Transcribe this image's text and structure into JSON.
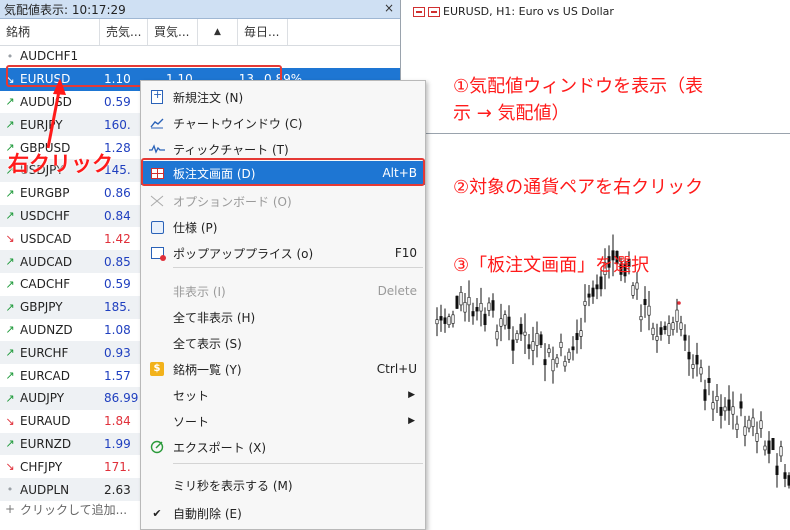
{
  "market_watch": {
    "title": "気配値表示: 10:17:29",
    "close": "×",
    "columns": [
      "銘柄",
      "売気...",
      "買気...",
      "▲",
      "毎日..."
    ],
    "rows": [
      {
        "arrow": "•",
        "dir": "neu",
        "symbol": "AUDCHF1",
        "bid": "",
        "ask": "",
        "spread": "",
        "change": "",
        "bid_color": "blue"
      },
      {
        "arrow": "↘",
        "dir": "dn",
        "symbol": "EURUSD",
        "bid": "1.10",
        "ask": "1.10",
        "spread": "13",
        "change": "0.89%",
        "bid_color": "blue",
        "selected": true
      },
      {
        "arrow": "↗",
        "dir": "up",
        "symbol": "AUDUSD",
        "bid": "0.59",
        "ask": "",
        "spread": "",
        "change": "",
        "bid_color": "blue"
      },
      {
        "arrow": "↗",
        "dir": "up",
        "symbol": "EURJPY",
        "bid": "160.",
        "ask": "",
        "spread": "",
        "change": "",
        "bid_color": "blue"
      },
      {
        "arrow": "↗",
        "dir": "up",
        "symbol": "GBPUSD",
        "bid": "1.28",
        "ask": "",
        "spread": "",
        "change": "",
        "bid_color": "blue"
      },
      {
        "arrow": "↗",
        "dir": "up",
        "symbol": "USDJPY",
        "bid": "145.",
        "ask": "",
        "spread": "",
        "change": "",
        "bid_color": "blue"
      },
      {
        "arrow": "↗",
        "dir": "up",
        "symbol": "EURGBP",
        "bid": "0.86",
        "ask": "",
        "spread": "",
        "change": "",
        "bid_color": "blue"
      },
      {
        "arrow": "↗",
        "dir": "up",
        "symbol": "USDCHF",
        "bid": "0.84",
        "ask": "",
        "spread": "",
        "change": "",
        "bid_color": "blue"
      },
      {
        "arrow": "↘",
        "dir": "dn",
        "symbol": "USDCAD",
        "bid": "1.42",
        "ask": "",
        "spread": "",
        "change": "",
        "bid_color": "red"
      },
      {
        "arrow": "↗",
        "dir": "up",
        "symbol": "AUDCAD",
        "bid": "0.85",
        "ask": "",
        "spread": "",
        "change": "",
        "bid_color": "blue"
      },
      {
        "arrow": "↗",
        "dir": "up",
        "symbol": "CADCHF",
        "bid": "0.59",
        "ask": "",
        "spread": "",
        "change": "",
        "bid_color": "blue"
      },
      {
        "arrow": "↗",
        "dir": "up",
        "symbol": "GBPJPY",
        "bid": "185.",
        "ask": "",
        "spread": "",
        "change": "",
        "bid_color": "blue"
      },
      {
        "arrow": "↗",
        "dir": "up",
        "symbol": "AUDNZD",
        "bid": "1.08",
        "ask": "",
        "spread": "",
        "change": "",
        "bid_color": "blue"
      },
      {
        "arrow": "↗",
        "dir": "up",
        "symbol": "EURCHF",
        "bid": "0.93",
        "ask": "",
        "spread": "",
        "change": "",
        "bid_color": "blue"
      },
      {
        "arrow": "↗",
        "dir": "up",
        "symbol": "EURCAD",
        "bid": "1.57",
        "ask": "",
        "spread": "",
        "change": "",
        "bid_color": "blue"
      },
      {
        "arrow": "↗",
        "dir": "up",
        "symbol": "AUDJPY",
        "bid": "86.99",
        "ask": "",
        "spread": "",
        "change": "",
        "bid_color": "blue"
      },
      {
        "arrow": "↘",
        "dir": "dn",
        "symbol": "EURAUD",
        "bid": "1.84",
        "ask": "",
        "spread": "",
        "change": "",
        "bid_color": "red"
      },
      {
        "arrow": "↗",
        "dir": "up",
        "symbol": "EURNZD",
        "bid": "1.99",
        "ask": "",
        "spread": "",
        "change": "",
        "bid_color": "blue"
      },
      {
        "arrow": "↘",
        "dir": "dn",
        "symbol": "CHFJPY",
        "bid": "171.",
        "ask": "",
        "spread": "",
        "change": "",
        "bid_color": "red"
      },
      {
        "arrow": "•",
        "dir": "neu",
        "symbol": "AUDPLN",
        "bid": "2.63",
        "ask": "",
        "spread": "",
        "change": "",
        "bid_color": "plain"
      }
    ],
    "add_symbol": "クリックして追加..."
  },
  "chart": {
    "title": "EURUSD, H1:  Euro vs US Dollar"
  },
  "context_menu": {
    "items": [
      {
        "icon": "new-order-icon",
        "label": "新規注文 (N)",
        "shortcut": "",
        "disabled": false
      },
      {
        "icon": "chart-window-icon",
        "label": "チャートウインドウ (C)",
        "shortcut": "",
        "disabled": false
      },
      {
        "icon": "tick-chart-icon",
        "label": "ティックチャート (T)",
        "shortcut": "",
        "disabled": false
      },
      {
        "icon": "depth-of-market-icon",
        "label": "板注文画面 (D)",
        "shortcut": "Alt+B",
        "disabled": false,
        "highlighted": true
      },
      {
        "icon": "option-board-icon",
        "label": "オプションボード (O)",
        "shortcut": "",
        "disabled": true
      },
      {
        "icon": "specification-icon",
        "label": "仕様 (P)",
        "shortcut": "",
        "disabled": false
      },
      {
        "icon": "popup-prices-icon",
        "label": "ポップアッププライス (o)",
        "shortcut": "F10",
        "disabled": false
      },
      {
        "icon": "",
        "label": "非表示 (I)",
        "shortcut": "Delete",
        "disabled": true
      },
      {
        "icon": "",
        "label": "全て非表示 (H)",
        "shortcut": "",
        "disabled": false
      },
      {
        "icon": "",
        "label": "全て表示 (S)",
        "shortcut": "",
        "disabled": false
      },
      {
        "icon": "symbols-icon",
        "label": "銘柄一覧 (Y)",
        "shortcut": "Ctrl+U",
        "disabled": false
      },
      {
        "icon": "",
        "label": "セット",
        "shortcut": "",
        "submenu": true,
        "disabled": false
      },
      {
        "icon": "",
        "label": "ソート",
        "shortcut": "",
        "submenu": true,
        "disabled": false
      },
      {
        "icon": "export-icon",
        "label": "エクスポート (X)",
        "shortcut": "",
        "disabled": false
      },
      {
        "icon": "",
        "label": "ミリ秒を表示する (M)",
        "shortcut": "",
        "disabled": false
      },
      {
        "icon": "check-icon",
        "label": "自動削除 (E)",
        "shortcut": "",
        "disabled": false
      }
    ]
  },
  "annotations": {
    "right_click": "右クリック",
    "step1_line1": "①気配値ウィンドウを表示（表",
    "step1_line2": "示 → 気配値）",
    "step2": "②対象の通貨ペアを右クリック",
    "step3": "③「板注文画面」を選択"
  }
}
